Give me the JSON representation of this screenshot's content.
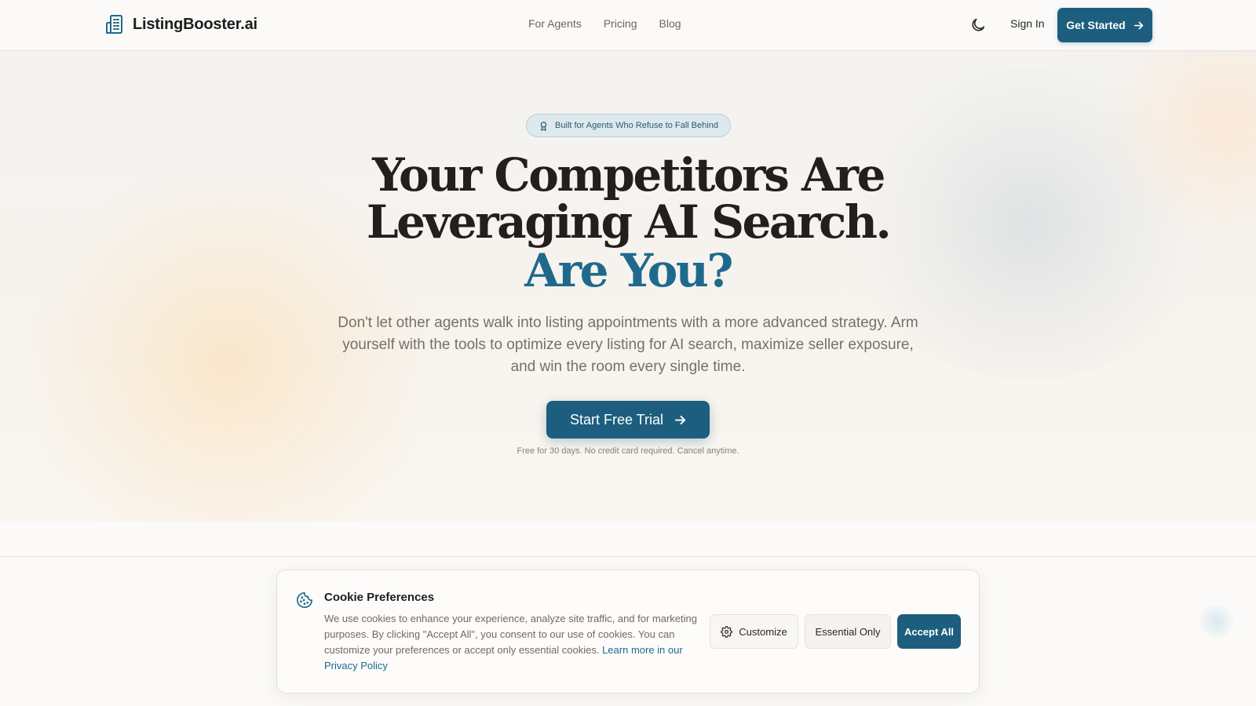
{
  "header": {
    "brand": "ListingBooster.ai",
    "brand_icon": "building-icon",
    "nav": [
      "For Agents",
      "Pricing",
      "Blog"
    ],
    "theme_icon": "moon-icon",
    "sign_in": "Sign In",
    "get_started": "Get Started"
  },
  "hero": {
    "badge": "Built for Agents Who Refuse to Fall Behind",
    "badge_icon": "award-icon",
    "headline_line1": "Your Competitors Are",
    "headline_line2": "Leveraging AI Search.",
    "headline_accent": "Are You?",
    "subhead": "Don't let other agents walk into listing appointments with a more advanced strategy. Arm yourself with the tools to optimize every listing for AI search, maximize seller exposure, and win the room every single time.",
    "cta": "Start Free Trial",
    "note": "Free for 30 days. No credit card required. Cancel anytime."
  },
  "cookie": {
    "title": "Cookie Preferences",
    "icon": "cookie-icon",
    "text": "We use cookies to enhance your experience, analyze site traffic, and for marketing purposes. By clicking \"Accept All\", you consent to our use of cookies. You can customize your preferences or accept only essential cookies.",
    "link": "Learn more in our Privacy Policy",
    "customize": "Customize",
    "essential": "Essential Only",
    "accept": "Accept All"
  },
  "colors": {
    "primary": "#1d5e7f",
    "accent_text": "#1f6a8c",
    "background": "#fbfaf8"
  }
}
